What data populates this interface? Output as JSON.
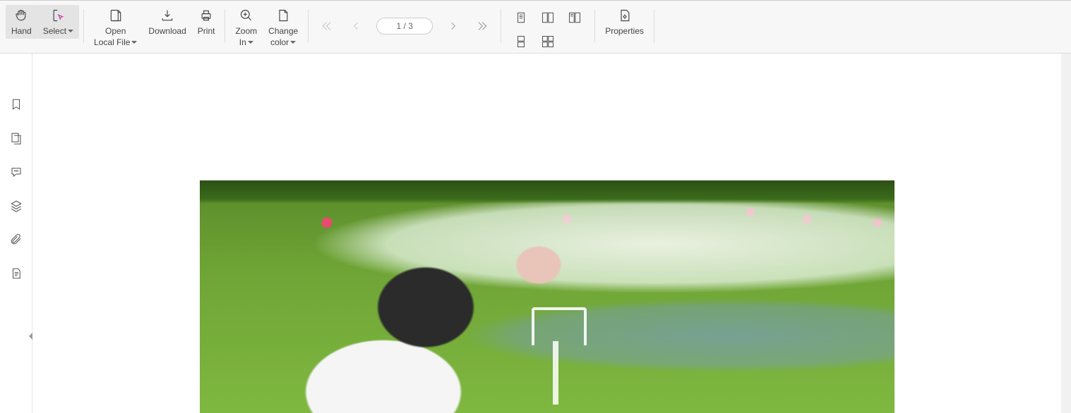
{
  "toolbar": {
    "hand": "Hand",
    "select": "Select",
    "open_l1": "Open",
    "open_l2": "Local File",
    "download": "Download",
    "print": "Print",
    "zoom_l1": "Zoom",
    "zoom_l2": "In",
    "color_l1": "Change",
    "color_l2": "color",
    "properties": "Properties"
  },
  "pager": {
    "value": "1 / 3"
  },
  "view_modes": {
    "a": "single-page",
    "b": "two-page",
    "c": "cover-page",
    "d": "continuous-single",
    "e": "continuous-two",
    "f": ""
  },
  "sidebar": {
    "bookmarks": "bookmarks",
    "thumbnails": "thumbnails",
    "comments": "comments",
    "layers": "layers",
    "attachments": "attachments",
    "outline": "outline"
  }
}
